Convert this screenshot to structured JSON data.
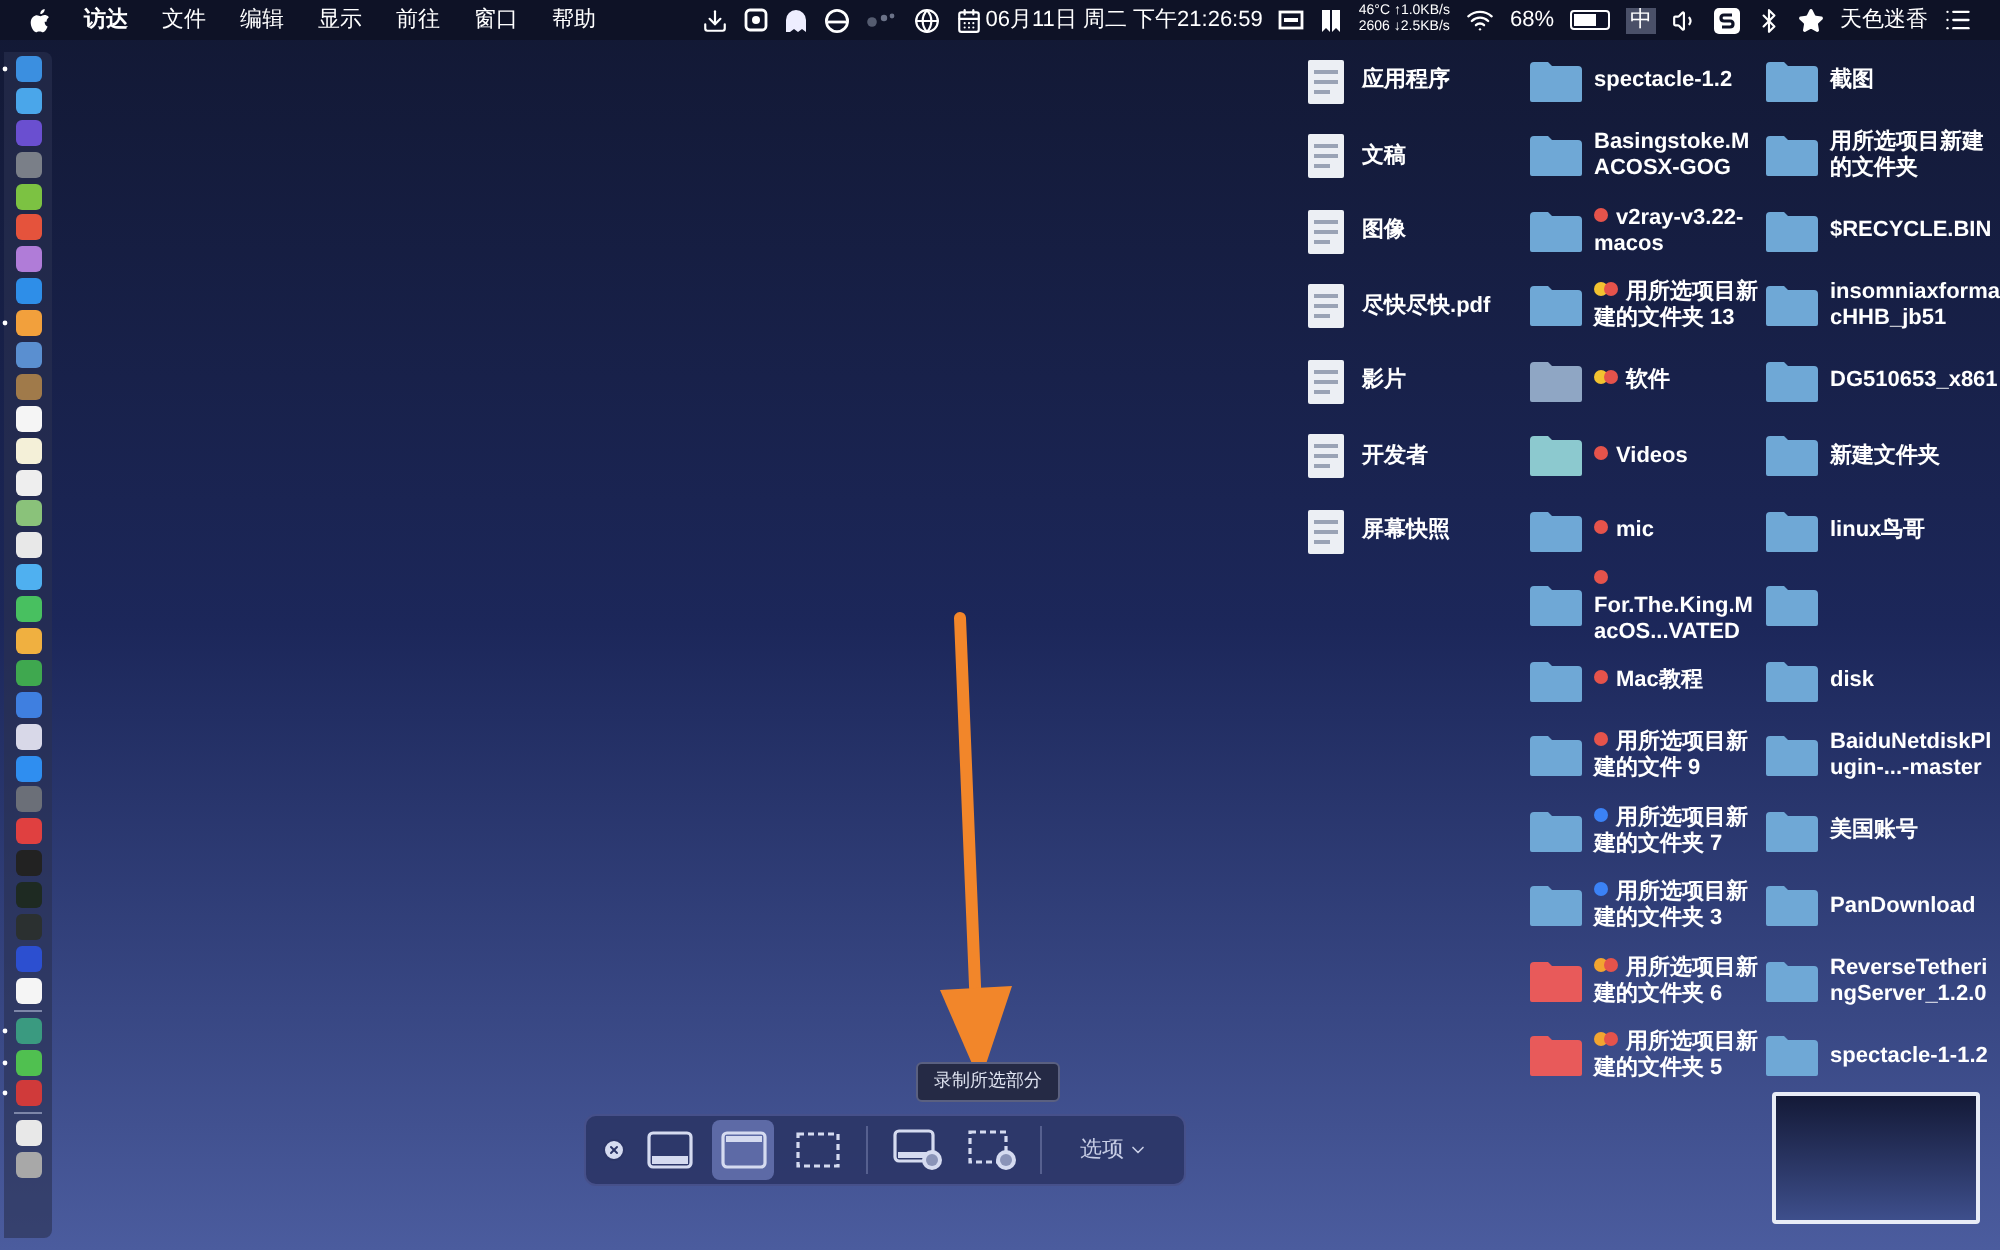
{
  "menu_bar": {
    "menus": [
      "访达",
      "文件",
      "编辑",
      "显示",
      "前往",
      "窗口",
      "帮助"
    ],
    "clock": "06月11日 周二 下午21:26:59",
    "stats": [
      "46°C ↑1.0KB/s",
      "2606 ↓2.5KB/s"
    ],
    "battery": {
      "reading": "68%",
      "level": 0.68
    },
    "input_method": "中",
    "user": "天色迷香"
  },
  "dock": {
    "items": [
      {
        "kind": "app",
        "color": "#3b8fe0",
        "running": true
      },
      {
        "kind": "app",
        "color": "#4aa6ea",
        "running": false
      },
      {
        "kind": "app",
        "color": "#6a4fd0",
        "running": false
      },
      {
        "kind": "app",
        "color": "#7a7f88",
        "running": false
      },
      {
        "kind": "app",
        "color": "#7cc242",
        "running": false
      },
      {
        "kind": "app",
        "color": "#e5533c",
        "running": false
      },
      {
        "kind": "app",
        "color": "#b07cd8",
        "running": false
      },
      {
        "kind": "app",
        "color": "#2e8ee8",
        "running": false
      },
      {
        "kind": "app",
        "color": "#f2a03c",
        "running": true
      },
      {
        "kind": "app",
        "color": "#5a8fd0",
        "running": false
      },
      {
        "kind": "app",
        "color": "#a07a4a",
        "running": false
      },
      {
        "kind": "app",
        "color": "#f5f5f5",
        "running": false
      },
      {
        "kind": "app",
        "color": "#f4f0d8",
        "running": false
      },
      {
        "kind": "app",
        "color": "#eeeeee",
        "running": false
      },
      {
        "kind": "app",
        "color": "#8ac27a",
        "running": false
      },
      {
        "kind": "app",
        "color": "#e8e8e8",
        "running": false
      },
      {
        "kind": "app",
        "color": "#4fb0f0",
        "running": false
      },
      {
        "kind": "app",
        "color": "#48c060",
        "running": false
      },
      {
        "kind": "app",
        "color": "#f0b040",
        "running": false
      },
      {
        "kind": "app",
        "color": "#3fa84f",
        "running": false
      },
      {
        "kind": "app",
        "color": "#3f7fe0",
        "running": false
      },
      {
        "kind": "app",
        "color": "#d8d8e8",
        "running": false
      },
      {
        "kind": "app",
        "color": "#2f8ef0",
        "running": false
      },
      {
        "kind": "app",
        "color": "#6b6f78",
        "running": false
      },
      {
        "kind": "app",
        "color": "#e04040",
        "running": false
      },
      {
        "kind": "app",
        "color": "#222222",
        "running": false
      },
      {
        "kind": "app",
        "color": "#1e2a22",
        "running": false
      },
      {
        "kind": "app",
        "color": "#2b3030",
        "running": false
      },
      {
        "kind": "app",
        "color": "#2c4fd0",
        "running": false
      },
      {
        "kind": "app",
        "color": "#f5f5f5",
        "running": false
      },
      {
        "kind": "separator"
      },
      {
        "kind": "app",
        "color": "#3a9a80",
        "running": true
      },
      {
        "kind": "app",
        "color": "#50c050",
        "running": true
      },
      {
        "kind": "app",
        "color": "#d03a3a",
        "running": true
      },
      {
        "kind": "separator"
      },
      {
        "kind": "app",
        "color": "#e8e8e8",
        "running": false
      },
      {
        "kind": "app",
        "color": "#a8a8a8",
        "running": false
      }
    ]
  },
  "desktop": {
    "columns": [
      [
        {
          "kind": "file",
          "label": "应用程序"
        },
        {
          "kind": "file",
          "label": "文稿"
        },
        {
          "kind": "file",
          "label": "图像"
        },
        {
          "kind": "file",
          "label": "尽快尽快.pdf"
        },
        {
          "kind": "file",
          "label": "影片"
        },
        {
          "kind": "file",
          "label": "开发者"
        },
        {
          "kind": "file",
          "label": "屏幕快照"
        }
      ],
      [
        {
          "kind": "folder",
          "color": "#6fa8d6",
          "label": "spectacle-1.2"
        },
        {
          "kind": "folder",
          "color": "#6fa8d6",
          "label": "Basingstoke.MACOSX-GOG"
        },
        {
          "kind": "folder",
          "color": "#6fa8d6",
          "label": "v2ray-v3.22-macos",
          "tags": [
            {
              "color": "#e5534b"
            }
          ]
        },
        {
          "kind": "folder",
          "color": "#6fa8d6",
          "label": "用所选项目新建的文件夹 13",
          "tags": [
            {
              "color": "#f2c230"
            },
            {
              "color": "#e5534b"
            }
          ]
        },
        {
          "kind": "folder",
          "color": "#8fa6c4",
          "label": "软件",
          "tags": [
            {
              "color": "#f2c230"
            },
            {
              "color": "#e5534b"
            }
          ]
        },
        {
          "kind": "folder",
          "color": "#8cc9cf",
          "label": "Videos",
          "tags": [
            {
              "color": "#e5534b"
            }
          ]
        },
        {
          "kind": "folder",
          "color": "#6fa8d6",
          "label": "mic",
          "tags": [
            {
              "color": "#e5534b"
            }
          ]
        },
        {
          "kind": "folder",
          "color": "#6fa8d6",
          "label": "For.The.King.MacOS...VATED",
          "tags": [
            {
              "color": "#e5534b"
            }
          ]
        },
        {
          "kind": "folder",
          "color": "#6fa8d6",
          "label": "Mac教程",
          "tags": [
            {
              "color": "#e5534b"
            }
          ]
        },
        {
          "kind": "folder",
          "color": "#6fa8d6",
          "label": "用所选项目新建的文件 9",
          "tags": [
            {
              "color": "#e5534b"
            }
          ]
        },
        {
          "kind": "folder",
          "color": "#6fa8d6",
          "label": "用所选项目新建的文件夹 7",
          "tags": [
            {
              "color": "#3b82f6"
            }
          ]
        },
        {
          "kind": "folder",
          "color": "#6fa8d6",
          "label": "用所选项目新建的文件夹 3",
          "tags": [
            {
              "color": "#3b82f6"
            }
          ]
        },
        {
          "kind": "folder",
          "color": "#e85a5a",
          "label": "用所选项目新建的文件夹 6",
          "tags": [
            {
              "color": "#f2a530"
            },
            {
              "color": "#e5534b"
            }
          ]
        },
        {
          "kind": "folder",
          "color": "#e85a5a",
          "label": "用所选项目新建的文件夹 5",
          "tags": [
            {
              "color": "#f2a530"
            },
            {
              "color": "#e5534b"
            }
          ]
        }
      ],
      [
        {
          "kind": "folder",
          "color": "#6fa8d6",
          "label": "截图"
        },
        {
          "kind": "folder",
          "color": "#6fa8d6",
          "label": "用所选项目新建的文件夹"
        },
        {
          "kind": "folder",
          "color": "#6fa8d6",
          "label": "$RECYCLE.BIN"
        },
        {
          "kind": "folder",
          "color": "#6fa8d6",
          "label": "insomniaxformacHHB_jb51"
        },
        {
          "kind": "folder",
          "color": "#6fa8d6",
          "label": "DG510653_x861"
        },
        {
          "kind": "folder",
          "color": "#6fa8d6",
          "label": "新建文件夹"
        },
        {
          "kind": "folder",
          "color": "#6fa8d6",
          "label": "linux鸟哥"
        },
        {
          "kind": "folder",
          "color": "#6fa8d6"
        },
        {
          "kind": "folder",
          "color": "#6fa8d6",
          "label": "disk"
        },
        {
          "kind": "folder",
          "color": "#6fa8d6",
          "label": "BaiduNetdiskPlugin-...-master"
        },
        {
          "kind": "folder",
          "color": "#6fa8d6",
          "label": "美国账号"
        },
        {
          "kind": "folder",
          "color": "#6fa8d6",
          "label": "PanDownload"
        },
        {
          "kind": "folder",
          "color": "#6fa8d6",
          "label": "ReverseTetheringServer_1.2.0"
        },
        {
          "kind": "folder",
          "color": "#6fa8d6",
          "label": "spectacle-1-1.2"
        }
      ]
    ]
  },
  "capture_toolbar": {
    "tooltip": "录制所选部分",
    "tools": [
      {
        "kind": "close"
      },
      {
        "kind": "screen",
        "selected": false
      },
      {
        "kind": "window",
        "selected": true
      },
      {
        "kind": "selection",
        "selected": false
      },
      {
        "kind": "divider"
      },
      {
        "kind": "record-screen",
        "selected": false
      },
      {
        "kind": "record-selection",
        "selected": false
      },
      {
        "kind": "divider"
      }
    ],
    "options": "选项"
  }
}
